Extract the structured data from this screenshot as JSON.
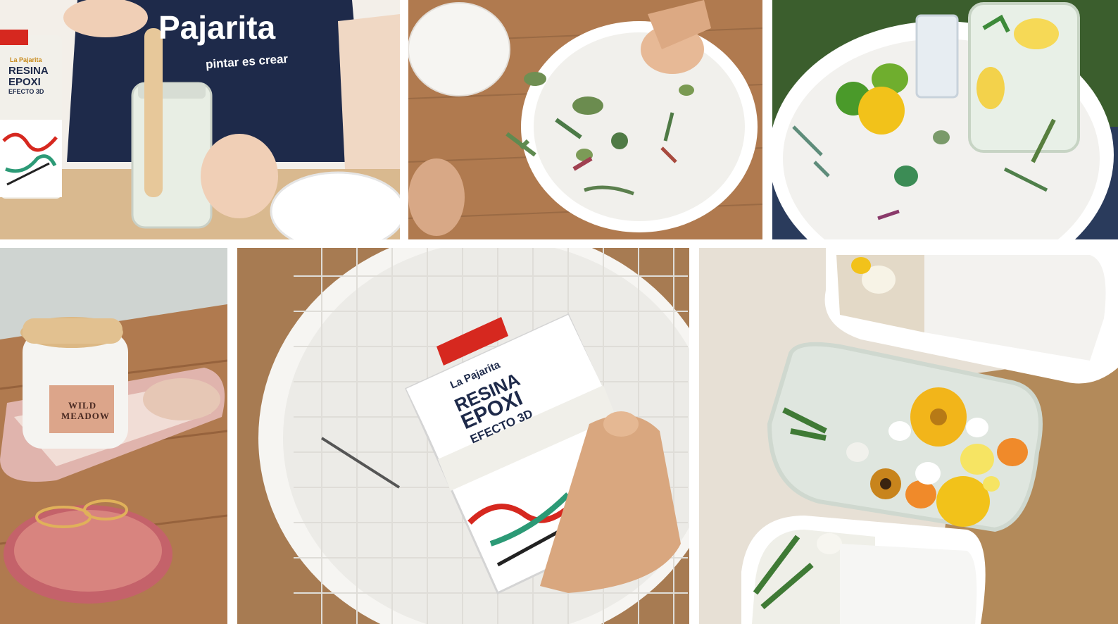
{
  "photos": {
    "p1": {
      "apron_brand": "Pajarita",
      "apron_tagline": "pintar es crear",
      "can_brand": "La Pajarita",
      "can_line1": "RESINA",
      "can_line2": "EPOXI",
      "can_line3": "EFECTO 3D"
    },
    "p4": {
      "candle_line1": "WILD",
      "candle_line2": "MEADOW"
    },
    "p5": {
      "can_brand": "La Pajarita",
      "can_line1": "RESINA",
      "can_line2": "EPOXI",
      "can_line3": "EFECTO 3D"
    }
  },
  "colors": {
    "brand_red": "#d6281f",
    "navy": "#1e2a4a",
    "wood": "#b07a4f",
    "resin_white": "#f4f2ee",
    "pink_resin": "#d98a86",
    "flower_yellow": "#f2c21a"
  }
}
